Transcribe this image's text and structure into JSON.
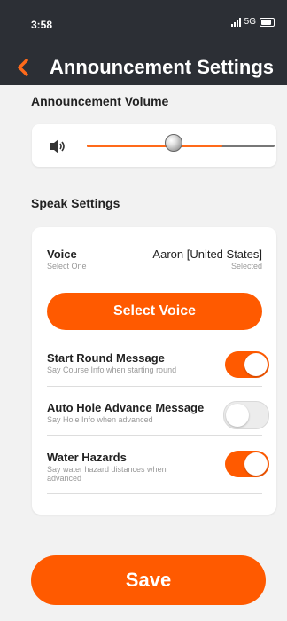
{
  "status_bar": {
    "time": "3:58",
    "network": "5G"
  },
  "nav": {
    "title": "Announcement Settings",
    "back_icon": "chevron-left-icon"
  },
  "volume": {
    "section_title": "Announcement Volume",
    "icon": "speaker-icon",
    "level_fraction": 0.72,
    "accent": "#ff6a1a"
  },
  "speak": {
    "section_title": "Speak Settings",
    "voice": {
      "label": "Voice",
      "sub": "Select One",
      "value": "Aaron [United States]",
      "status": "Selected"
    },
    "select_voice_label": "Select Voice",
    "settings": [
      {
        "title": "Start Round Message",
        "sub": "Say Course Info when starting round",
        "on": true
      },
      {
        "title": "Auto Hole Advance Message",
        "sub": "Say Hole Info when advanced",
        "on": false
      },
      {
        "title": "Water Hazards",
        "sub": "Say water hazard distances when advanced",
        "on": true
      }
    ]
  },
  "save_label": "Save",
  "colors": {
    "header": "#2c2f35",
    "accent": "#ff5a00",
    "background": "#f2f2f2"
  }
}
